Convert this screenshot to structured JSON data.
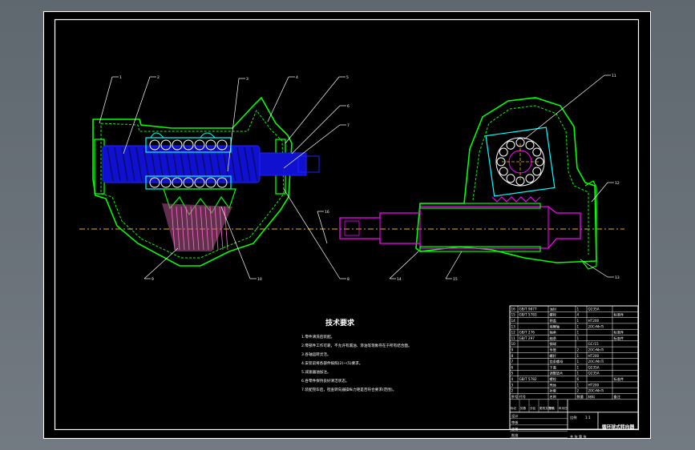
{
  "colors": {
    "background": "#6c737b",
    "sheet": "#000000",
    "frame": "#ffffff",
    "housing": "#00ff00",
    "worm": "#1f1fff",
    "shaft": "#ff00ff",
    "nut": "#00ffff",
    "centerline": "#e6b800",
    "leader": "#ffffff"
  },
  "requirements": {
    "title": "技术要求",
    "items": [
      "1.零件清洗后装配。",
      "2.零部件工作可靠，不允许有漏油、渗油等现象存在于所有结合面。",
      "3.各轴运转灵活。",
      "4.安装前将各部件按照(2)~(5)要求。",
      "5.减速器油加注。",
      "6.各零件保持良好清洁状态。",
      "7.装配完毕后，检查转向器操纵力矩是否符合要求(范围)。"
    ]
  },
  "title_block": {
    "drawing_title": "循环球式转向器",
    "parts_rows": [
      {
        "no": "16",
        "code": "GB/T 9877",
        "name": "油封",
        "qty": "1",
        "material": "Q235A",
        "note": ""
      },
      {
        "no": "15",
        "code": "GB/T 5783",
        "name": "螺栓",
        "qty": "4",
        "material": "",
        "note": "标准件"
      },
      {
        "no": "14",
        "code": "",
        "name": "侧盖",
        "qty": "1",
        "material": "HT200",
        "note": ""
      },
      {
        "no": "13",
        "code": "",
        "name": "摇臂轴",
        "qty": "1",
        "material": "20CrMnTi",
        "note": ""
      },
      {
        "no": "12",
        "code": "GB/T 276",
        "name": "轴承",
        "qty": "1",
        "material": "",
        "note": "标准件"
      },
      {
        "no": "11",
        "code": "GB/T 297",
        "name": "轴承",
        "qty": "1",
        "material": "",
        "note": "标准件"
      },
      {
        "no": "10",
        "code": "",
        "name": "钢球",
        "qty": "",
        "material": "GCr15",
        "note": ""
      },
      {
        "no": "9",
        "code": "",
        "name": "导管",
        "qty": "2",
        "material": "20CrMnTi",
        "note": ""
      },
      {
        "no": "8",
        "code": "",
        "name": "螺杆",
        "qty": "1",
        "material": "HT200",
        "note": ""
      },
      {
        "no": "7",
        "code": "",
        "name": "齿条螺母",
        "qty": "1",
        "material": "20CrMnTi",
        "note": ""
      },
      {
        "no": "6",
        "code": "",
        "name": "下盖",
        "qty": "1",
        "material": "Q235A",
        "note": ""
      },
      {
        "no": "5",
        "code": "",
        "name": "调整垫片",
        "qty": "1",
        "material": "Q235A",
        "note": ""
      },
      {
        "no": "4",
        "code": "GB/T 5782",
        "name": "螺栓",
        "qty": "6",
        "material": "",
        "note": "标准件"
      },
      {
        "no": "3",
        "code": "",
        "name": "壳体",
        "qty": "1",
        "material": "HT200",
        "note": ""
      },
      {
        "no": "2",
        "code": "",
        "name": "衬套",
        "qty": "2",
        "material": "20CrMnTi",
        "note": ""
      }
    ],
    "header": {
      "no": "序号",
      "code": "代号",
      "name": "名称",
      "qty": "数量",
      "material": "材料",
      "note": "备注"
    },
    "sign_labels": [
      "标记",
      "处数",
      "分区",
      "更改文件号",
      "签名",
      "年月日"
    ],
    "role_labels": [
      "设计",
      "审核",
      "工艺",
      "批准"
    ],
    "scale_label": "比例",
    "scale": "1:1",
    "sheet_label": "共 张 第 张"
  },
  "callouts": [
    "1",
    "2",
    "3",
    "4",
    "5",
    "6",
    "7",
    "8",
    "9",
    "10",
    "11",
    "12",
    "13",
    "14",
    "15",
    "16"
  ]
}
